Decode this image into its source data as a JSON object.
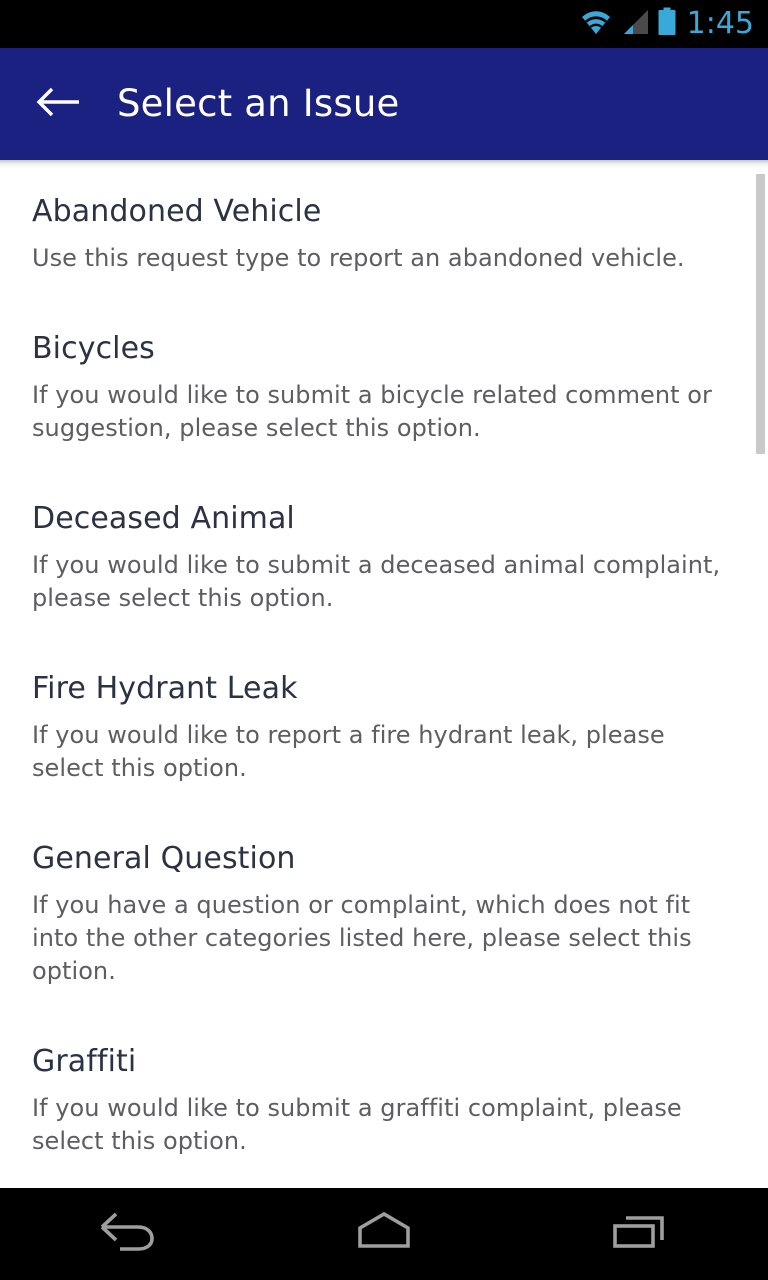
{
  "status_bar": {
    "time": "1:45",
    "accent_color": "#3ba9d8",
    "background": "#000000",
    "icons": [
      {
        "name": "wifi-icon",
        "label": "Wi-Fi connected"
      },
      {
        "name": "cellular-signal-icon",
        "label": "Cellular signal weak"
      },
      {
        "name": "battery-icon",
        "label": "Battery full"
      }
    ]
  },
  "app_bar": {
    "title": "Select an Issue",
    "background": "#1a2180",
    "title_color": "#ffffff",
    "back_icon": "arrow-left-icon"
  },
  "list": {
    "title_color": "#2b3244",
    "description_color": "#5e5e62",
    "items": [
      {
        "title": "Abandoned Vehicle",
        "description": "Use this request type to report an abandoned vehicle."
      },
      {
        "title": "Bicycles",
        "description": "If you would like to submit a bicycle related comment or suggestion, please select this option."
      },
      {
        "title": "Deceased Animal",
        "description": "If you would like to submit a deceased animal complaint, please select this option."
      },
      {
        "title": "Fire Hydrant Leak",
        "description": "If you would like to report a fire hydrant leak, please select this option."
      },
      {
        "title": "General Question",
        "description": "If you have a question or complaint, which does not fit into the other categories listed here, please select this option."
      },
      {
        "title": "Graffiti",
        "description": "If you would like to submit a graffiti complaint, please select this option."
      }
    ]
  },
  "scrollbar": {
    "thumb_color": "#c9c9c9",
    "visible": true
  },
  "nav_bar": {
    "background": "#000000",
    "icon_color": "#9e9e9e",
    "buttons": [
      {
        "name": "nav-back-button",
        "icon": "back-arrow-icon",
        "label": "Back"
      },
      {
        "name": "nav-home-button",
        "icon": "home-icon",
        "label": "Home"
      },
      {
        "name": "nav-recents-button",
        "icon": "recents-icon",
        "label": "Recent apps"
      }
    ]
  }
}
